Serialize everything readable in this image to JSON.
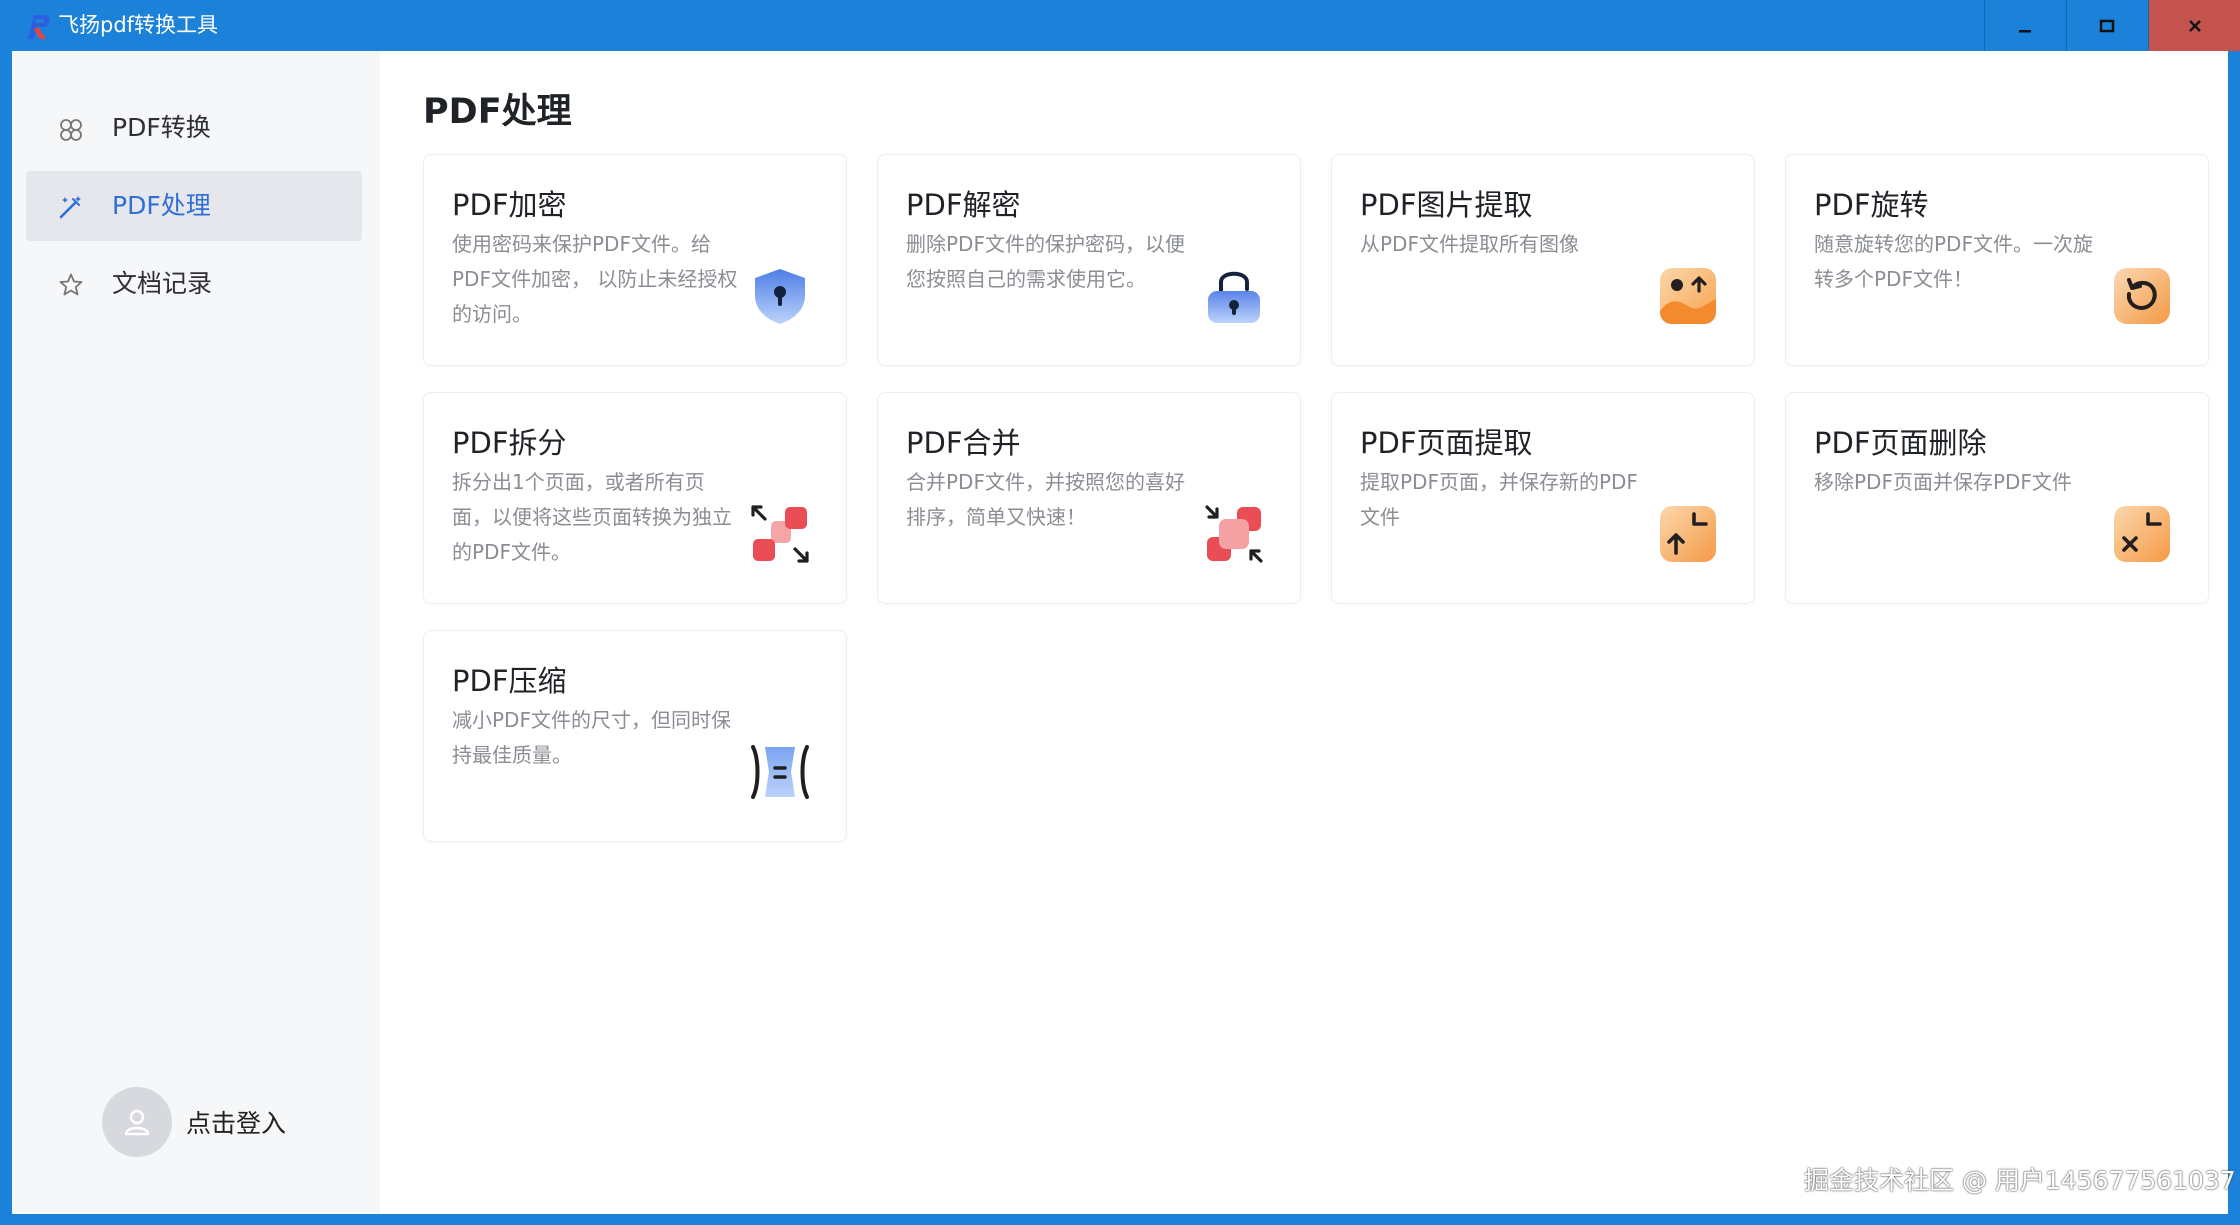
{
  "window": {
    "title": "飞扬pdf转换工具",
    "controls": {
      "minimize": "minimize-icon",
      "maximize": "maximize-icon",
      "close": "close-icon"
    },
    "colors": {
      "titlebar": "#1c82d9",
      "close_bg": "#c4534e"
    }
  },
  "sidebar": {
    "items": [
      {
        "label": "PDF转换",
        "icon": "convert-icon",
        "active": false
      },
      {
        "label": "PDF处理",
        "icon": "magic-wand-icon",
        "active": true
      },
      {
        "label": "文档记录",
        "icon": "star-icon",
        "active": false
      }
    ],
    "login": {
      "label": "点击登入",
      "icon": "user-icon"
    },
    "colors": {
      "active_text": "#2f6fd6",
      "active_bg": "#e5e7ec"
    }
  },
  "main": {
    "title": "PDF处理",
    "cards": [
      {
        "title": "PDF加密",
        "desc": "使用密码来保护PDF文件。给PDF文件加密， 以防止未经授权的访问。",
        "icon": "shield-lock-icon"
      },
      {
        "title": "PDF解密",
        "desc": "删除PDF文件的保护密码，以便您按照自己的需求使用它。",
        "icon": "padlock-icon"
      },
      {
        "title": "PDF图片提取",
        "desc": "从PDF文件提取所有图像",
        "icon": "image-extract-icon"
      },
      {
        "title": "PDF旋转",
        "desc": "随意旋转您的PDF文件。一次旋转多个PDF文件！",
        "icon": "rotate-icon"
      },
      {
        "title": "PDF拆分",
        "desc": "拆分出1个页面，或者所有页面，以便将这些页面转换为独立的PDF文件。",
        "icon": "split-icon"
      },
      {
        "title": "PDF合并",
        "desc": "合并PDF文件，并按照您的喜好排序，简单又快速！",
        "icon": "merge-icon"
      },
      {
        "title": "PDF页面提取",
        "desc": "提取PDF页面，并保存新的PDF文件",
        "icon": "page-extract-icon"
      },
      {
        "title": "PDF页面删除",
        "desc": "移除PDF页面并保存PDF文件",
        "icon": "page-delete-icon"
      },
      {
        "title": "PDF压缩",
        "desc": "减小PDF文件的尺寸，但同时保持最佳质量。",
        "icon": "compress-icon"
      }
    ]
  },
  "watermark": "掘金技术社区 @ 用户1456775610​37"
}
